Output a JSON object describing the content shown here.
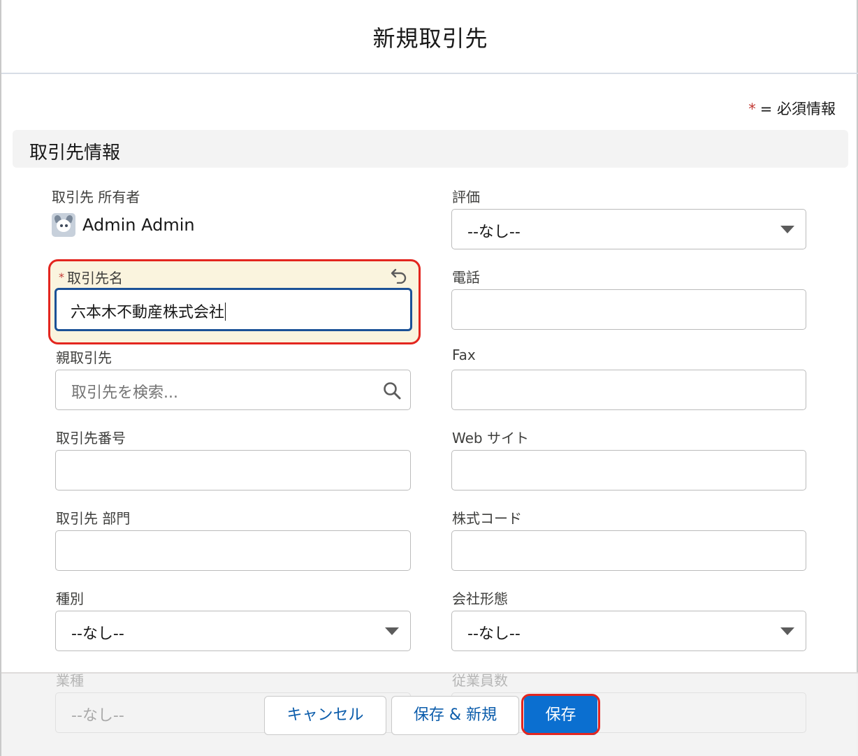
{
  "modal": {
    "title": "新規取引先",
    "required_legend_star": "*",
    "required_legend_text": "= 必須情報"
  },
  "section": {
    "title": "取引先情報"
  },
  "fields": {
    "owner": {
      "label": "取引先 所有者",
      "value": "Admin Admin"
    },
    "rating": {
      "label": "評価",
      "value": "--なし--"
    },
    "account_name": {
      "required_star": "*",
      "label": "取引先名",
      "value": "六本木不動産株式会社"
    },
    "phone": {
      "label": "電話",
      "value": ""
    },
    "parent_account": {
      "label": "親取引先",
      "placeholder": "取引先を検索..."
    },
    "fax": {
      "label": "Fax",
      "value": ""
    },
    "account_number": {
      "label": "取引先番号",
      "value": ""
    },
    "website": {
      "label": "Web サイト",
      "value": ""
    },
    "account_site": {
      "label": "取引先 部門",
      "value": ""
    },
    "ticker": {
      "label": "株式コード",
      "value": ""
    },
    "type": {
      "label": "種別",
      "value": "--なし--"
    },
    "ownership": {
      "label": "会社形態",
      "value": "--なし--"
    },
    "industry": {
      "label": "業種",
      "value": "--なし--"
    },
    "employees": {
      "label": "従業員数",
      "value": ""
    }
  },
  "footer": {
    "cancel_label": "キャンセル",
    "save_new_label": "保存 & 新規",
    "save_label": "保存"
  },
  "icons": {
    "undo": "undo-icon",
    "search": "search-icon",
    "dropdown": "chevron-down-icon",
    "avatar": "user-avatar"
  },
  "colors": {
    "brand": "#0b6fd0",
    "highlight": "#e3261f",
    "required": "#c23934",
    "focus": "#1b5297",
    "edited_field_bg": "#faf4de"
  }
}
